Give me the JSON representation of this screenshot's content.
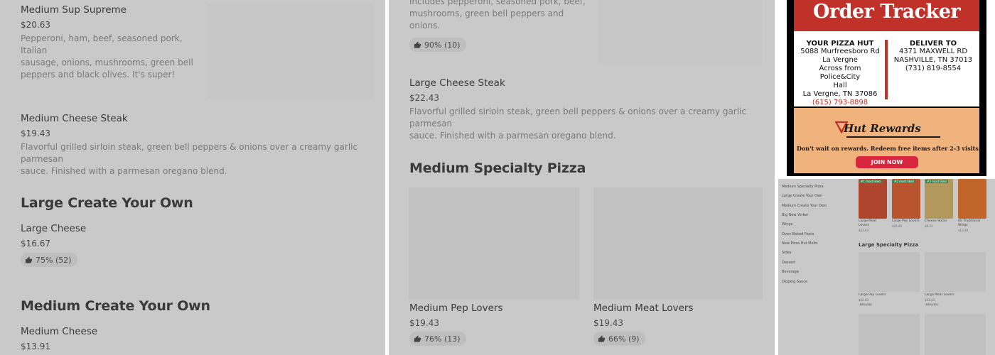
{
  "panel_left": {
    "item1": {
      "name": "Medium Sup Supreme",
      "price": "$20.63",
      "desc_lines": [
        "Pepperoni, ham, beef, seasoned pork, Italian",
        "sausage, onions, mushrooms, green bell",
        "peppers and black olives. It's super!"
      ]
    },
    "item2": {
      "name": "Medium Cheese Steak",
      "price": "$19.43",
      "desc_lines": [
        "Flavorful grilled sirloin steak, green bell peppers & onions over a creamy garlic parmesan",
        "sauce. Finished with a parmesan oregano blend."
      ]
    },
    "section1": "Large Create Your Own",
    "item3": {
      "name": "Large Cheese",
      "price": "$16.67",
      "rating": "75% (52)"
    },
    "section2": "Medium Create Your Own",
    "item4": {
      "name": "Medium Cheese",
      "price": "$13.91"
    }
  },
  "panel_middle": {
    "item1": {
      "desc_lines": [
        "Includes pepperoni, seasoned pork, beef,",
        "mushrooms, green bell peppers and onions."
      ],
      "rating": "90% (10)"
    },
    "item2": {
      "name": "Large Cheese Steak",
      "price": "$22.43",
      "desc_lines": [
        "Flavorful grilled sirloin steak, green bell peppers & onions over a creamy garlic parmesan",
        "sauce. Finished with a parmesan oregano blend."
      ]
    },
    "section": "Medium Specialty Pizza",
    "card1": {
      "name": "Medium Pep Lovers",
      "price": "$19.43",
      "rating": "76% (13)"
    },
    "card2": {
      "name": "Medium Meat Lovers",
      "price": "$19.43",
      "rating": "66% (9)"
    }
  },
  "tracker": {
    "title": "Order Tracker",
    "store": {
      "heading": "YOUR PIZZA HUT",
      "lines": [
        "5088 Murfreesboro Rd",
        "La Vergne",
        "Across from Police&City",
        "Hall",
        "La Vergne, TN 37086"
      ],
      "phone": "(615) 793-8898"
    },
    "deliver": {
      "heading": "DELIVER TO",
      "lines": [
        "4371 MAXWELL RD",
        "NASHVILLE, TN 37013",
        "(731) 819-8554"
      ]
    },
    "rewards_title": "Hut Rewards",
    "rewards_tagline": "Don't wait on rewards. Redeem free items after 2-3 visits.",
    "join_label": "JOIN NOW",
    "accent": "#c0312a"
  },
  "mini": {
    "categories": [
      "Medium Specialty Pizza",
      "Large Create Your Own",
      "Medium Create Your Own",
      "Big New Yorker",
      "Wings",
      "Oven Baked Pasta",
      "New Pizza Hut Melts",
      "Sides",
      "Dessert",
      "Beverage",
      "Dipping Sauce"
    ],
    "cards": [
      {
        "badge": "#1 most liked",
        "name1": "Large Meat",
        "name2": "Lovers",
        "price": "$22.43"
      },
      {
        "badge": "#2 most liked",
        "name1": "Large Pep Lovers",
        "name2": "",
        "price": "$22.43"
      },
      {
        "badge": "#3 most liked",
        "name1": "Cheese Sticks",
        "name2": "",
        "price": "$9.23"
      },
      {
        "badge": "",
        "name1": "(6) Traditional",
        "name2": "Wings",
        "price": "$12.00"
      }
    ],
    "section": "Large Specialty Pizza",
    "items": [
      {
        "name": "Large Pep Lovers",
        "price": "$22.43",
        "rating": "89% (36)"
      },
      {
        "name": "Large Meat Lovers",
        "price": "$22.43",
        "rating": "83% (30)"
      }
    ]
  }
}
